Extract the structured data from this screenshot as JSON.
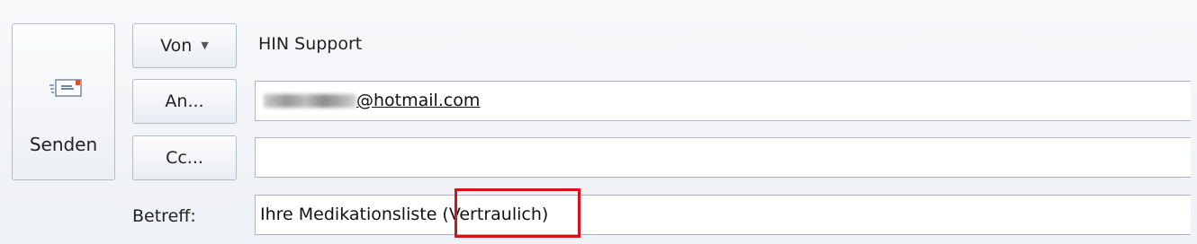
{
  "send": {
    "label": "Senden",
    "icon": "send-mail-icon"
  },
  "header": {
    "from_button_label": "Von",
    "from_value": "HIN Support",
    "to_button_label": "An...",
    "cc_button_label": "Cc...",
    "subject_label": "Betreff:"
  },
  "recipients": {
    "to_domain": "@hotmail.com",
    "cc_value": ""
  },
  "subject": {
    "value": "Ihre Medikationsliste (Vertraulich)"
  },
  "colors": {
    "accent": "#2f6db5",
    "highlight": "#d7121d"
  }
}
